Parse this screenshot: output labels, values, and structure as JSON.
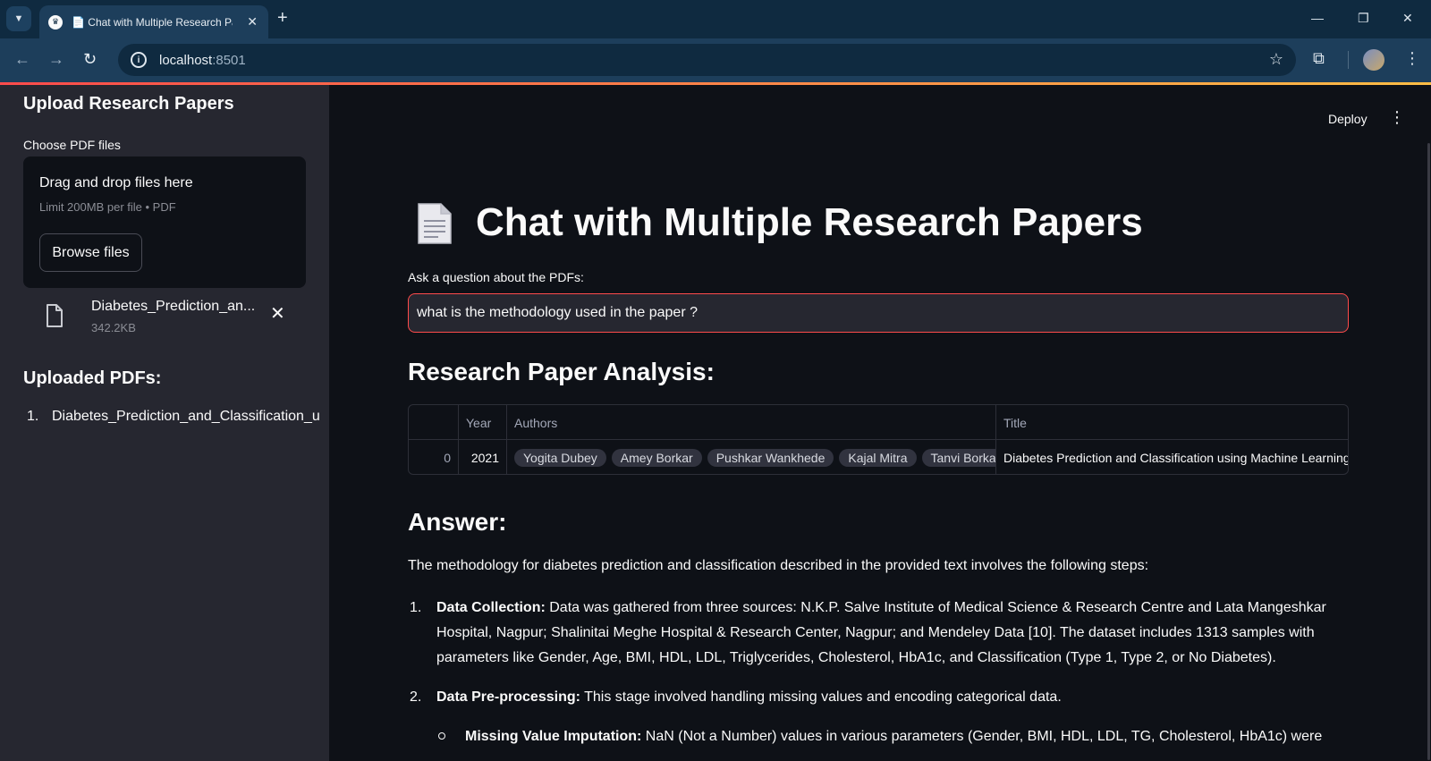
{
  "browser": {
    "tab_title": "📄 Chat with Multiple Research Papers",
    "url_host": "localhost",
    "url_port": ":8501"
  },
  "sidebar": {
    "upload_title": "Upload Research Papers",
    "file_label": "Choose PDF files",
    "dropzone_title": "Drag and drop files here",
    "dropzone_limit": "Limit 200MB per file • PDF",
    "browse_label": "Browse files",
    "uploaded_file": {
      "name": "Diabetes_Prediction_an...",
      "size": "342.2KB"
    },
    "uploaded_title": "Uploaded PDFs:",
    "pdf_list": [
      {
        "num": "1.",
        "name": "Diabetes_Prediction_and_Classification_u"
      }
    ]
  },
  "header": {
    "deploy_label": "Deploy"
  },
  "main": {
    "title": "Chat with Multiple Research Papers",
    "question_label": "Ask a question about the PDFs:",
    "question_value": "what is the methodology used in the paper ?",
    "analysis_title": "Research Paper Analysis:",
    "table": {
      "columns": [
        "",
        "Year",
        "Authors",
        "Title"
      ],
      "row": {
        "index": "0",
        "year": "2021",
        "authors": [
          "Yogita Dubey",
          "Amey Borkar",
          "Pushkar Wankhede",
          "Kajal Mitra",
          "Tanvi Borkar"
        ],
        "title": "Diabetes Prediction and Classification using Machine Learning"
      }
    },
    "answer_title": "Answer:",
    "answer_intro": "The methodology for diabetes prediction and classification described in the provided text involves the following steps:",
    "steps": [
      {
        "num": "1.",
        "label": "Data Collection:",
        "text": " Data was gathered from three sources: N.K.P. Salve Institute of Medical Science & Research Centre and Lata Mangeshkar Hospital, Nagpur; Shalinitai Meghe Hospital & Research Center, Nagpur; and Mendeley Data [10]. The dataset includes 1313 samples with parameters like Gender, Age, BMI, HDL, LDL, Triglycerides, Cholesterol, HbA1c, and Classification (Type 1, Type 2, or No Diabetes)."
      },
      {
        "num": "2.",
        "label": "Data Pre-processing:",
        "text": " This stage involved handling missing values and encoding categorical data."
      }
    ],
    "substep": {
      "label": "Missing Value Imputation:",
      "text": " NaN (Not a Number) values in various parameters (Gender, BMI, HDL, LDL, TG, Cholesterol, HbA1c) were"
    }
  },
  "colors": {
    "accent": "#ff4b4b",
    "sidebar_bg": "#262730",
    "main_bg": "#0e1117"
  }
}
